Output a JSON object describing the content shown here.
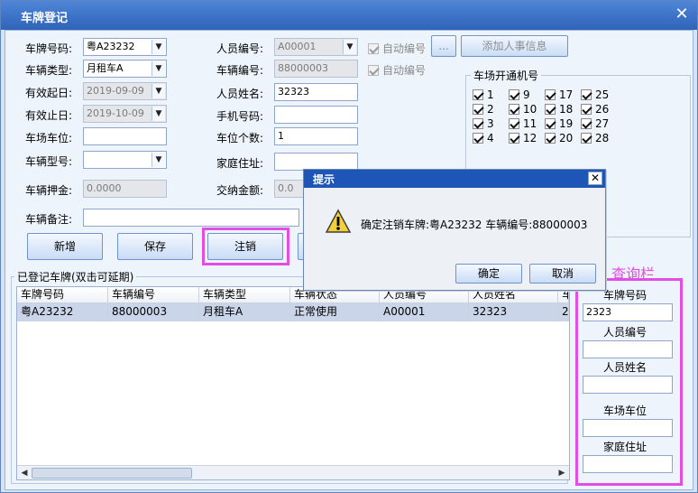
{
  "window": {
    "title": "车牌登记"
  },
  "left": {
    "plate_label": "车牌号码:",
    "plate_value": "粤A23232",
    "type_label": "车辆类型:",
    "type_value": "月租车A",
    "start_label": "有效起日:",
    "start_value": "2019-09-09",
    "end_label": "有效止日:",
    "end_value": "2019-10-09",
    "slot_label": "车场车位:",
    "model_label": "车辆型号:",
    "deposit_label": "车辆押金:",
    "deposit_value": "0.0000",
    "remark_label": "车辆备注:"
  },
  "middle": {
    "person_no_label": "人员编号:",
    "person_no_value": "A00001",
    "vehicle_no_label": "车辆编号:",
    "vehicle_no_value": "88000003",
    "person_name_label": "人员姓名:",
    "person_name_value": "32323",
    "phone_label": "手机号码:",
    "slots_label": "车位个数:",
    "slots_value": "1",
    "address_label": "家庭住址:",
    "paid_label": "交纳金额:",
    "paid_value": "0.0",
    "auto1": "自动编号",
    "auto2": "自动编号",
    "ellipsis": "...",
    "add_person": "添加人事信息"
  },
  "parking": {
    "title": "车场开通机号",
    "items": [
      "1",
      "9",
      "17",
      "25",
      "2",
      "10",
      "18",
      "26",
      "3",
      "11",
      "19",
      "27",
      "4",
      "12",
      "20",
      "28"
    ]
  },
  "buttons": {
    "add": "新增",
    "save": "保存",
    "cancel_reg": "注销"
  },
  "registered": {
    "title": "已登记车牌(双击可延期)",
    "columns": [
      "车牌号码",
      "车辆编号",
      "车辆类型",
      "车辆状态",
      "人员编号",
      "人员姓名",
      "车"
    ],
    "row": [
      "粤A23232",
      "88000003",
      "月租车A",
      "正常使用",
      "A00001",
      "32323",
      "20"
    ]
  },
  "query": {
    "title": "查询栏",
    "plate_label": "车牌号码",
    "plate_value": "2323",
    "person_no_label": "人员编号",
    "person_name_label": "人员姓名",
    "slot_label": "车场车位",
    "address_label": "家庭住址"
  },
  "dialog": {
    "title": "提示",
    "message": "确定注销车牌:粤A23232   车辆编号:88000003",
    "ok": "确定",
    "cancel": "取消"
  }
}
